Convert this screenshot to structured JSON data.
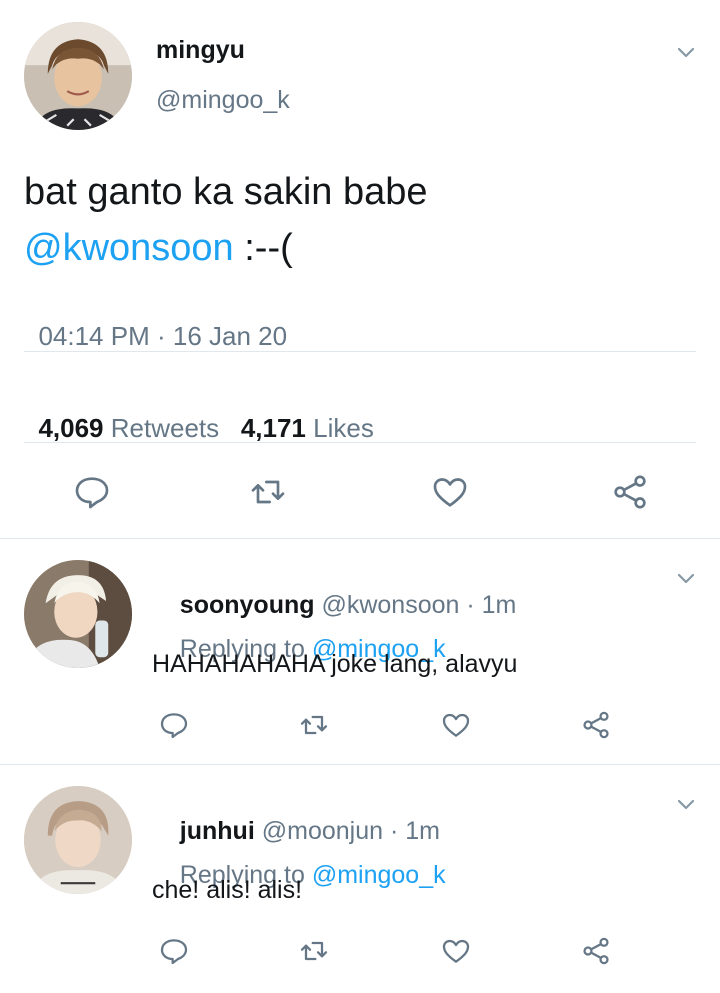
{
  "main_tweet": {
    "display_name": "mingyu",
    "handle": "@mingoo_k",
    "text_line1": "bat ganto ka sakin babe",
    "mention": "@kwonsoon",
    "text_suffix": " :--(",
    "time": "04:14 PM",
    "separator": "·",
    "date": "16 Jan 20",
    "retweets_count": "4,069",
    "retweets_label": "Retweets",
    "likes_count": "4,171",
    "likes_label": "Likes"
  },
  "replies": [
    {
      "display_name": "soonyoung",
      "handle": "@kwonsoon",
      "time_sep": "·",
      "time": "1m",
      "replying_prefix": "Replying to",
      "replying_handle": "@mingoo_k",
      "text": "HAHAHAHAHA joke lang, alavyu"
    },
    {
      "display_name": "junhui",
      "handle": "@moonjun",
      "time_sep": "·",
      "time": "1m",
      "replying_prefix": "Replying to",
      "replying_handle": "@mingoo_k",
      "text": "che! alis! alis!"
    }
  ],
  "icons": {
    "reply": "reply-icon",
    "retweet": "retweet-icon",
    "like": "like-icon",
    "share": "share-icon",
    "menu": "chevron-down-icon"
  },
  "colors": {
    "link": "#1da1f2",
    "secondary_text": "#657786",
    "divider": "#e1e8ed",
    "icon": "#657786"
  }
}
